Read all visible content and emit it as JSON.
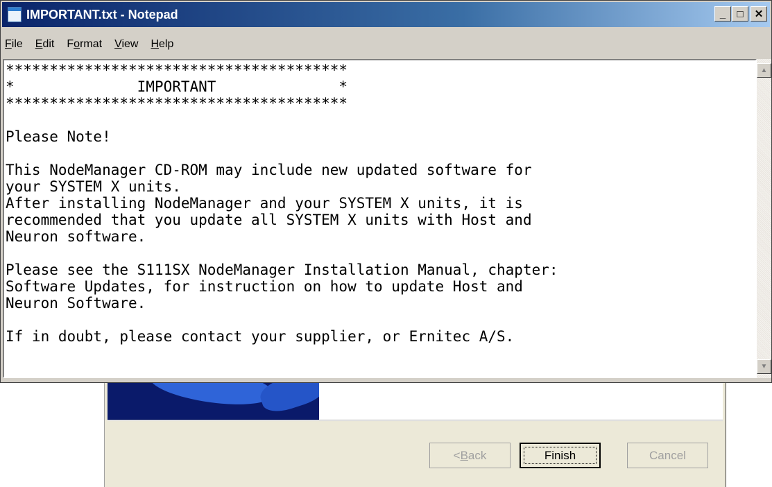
{
  "notepad": {
    "title": "IMPORTANT.txt - Notepad",
    "title_buttons": {
      "minimize": "_",
      "maximize": "□",
      "close": "✕"
    },
    "menu": [
      {
        "pre": "",
        "acc": "F",
        "post": "ile"
      },
      {
        "pre": "",
        "acc": "E",
        "post": "dit"
      },
      {
        "pre": "F",
        "acc": "o",
        "post": "rmat"
      },
      {
        "pre": "",
        "acc": "V",
        "post": "iew"
      },
      {
        "pre": "",
        "acc": "H",
        "post": "elp"
      }
    ],
    "content": "***************************************\n*              IMPORTANT              *\n***************************************\n\nPlease Note!\n\nThis NodeManager CD-ROM may include new updated software for\nyour SYSTEM X units.\nAfter installing NodeManager and your SYSTEM X units, it is\nrecommended that you update all SYSTEM X units with Host and\nNeuron software.\n\nPlease see the S111SX NodeManager Installation Manual, chapter:\nSoftware Updates, for instruction on how to update Host and\nNeuron Software.\n\nIf in doubt, please contact your supplier, or Ernitec A/S."
  },
  "scrollbar": {
    "up": "▲",
    "down": "▼"
  },
  "installer": {
    "back": {
      "pre": "< ",
      "acc": "B",
      "post": "ack"
    },
    "finish": "Finish",
    "cancel": "Cancel"
  },
  "colors": {
    "titlebar_start": "#0a246a",
    "titlebar_end": "#a6caf0",
    "window_face": "#d4d0c8",
    "dialog_face": "#ece9d8",
    "banner": "#0a1a6a"
  }
}
